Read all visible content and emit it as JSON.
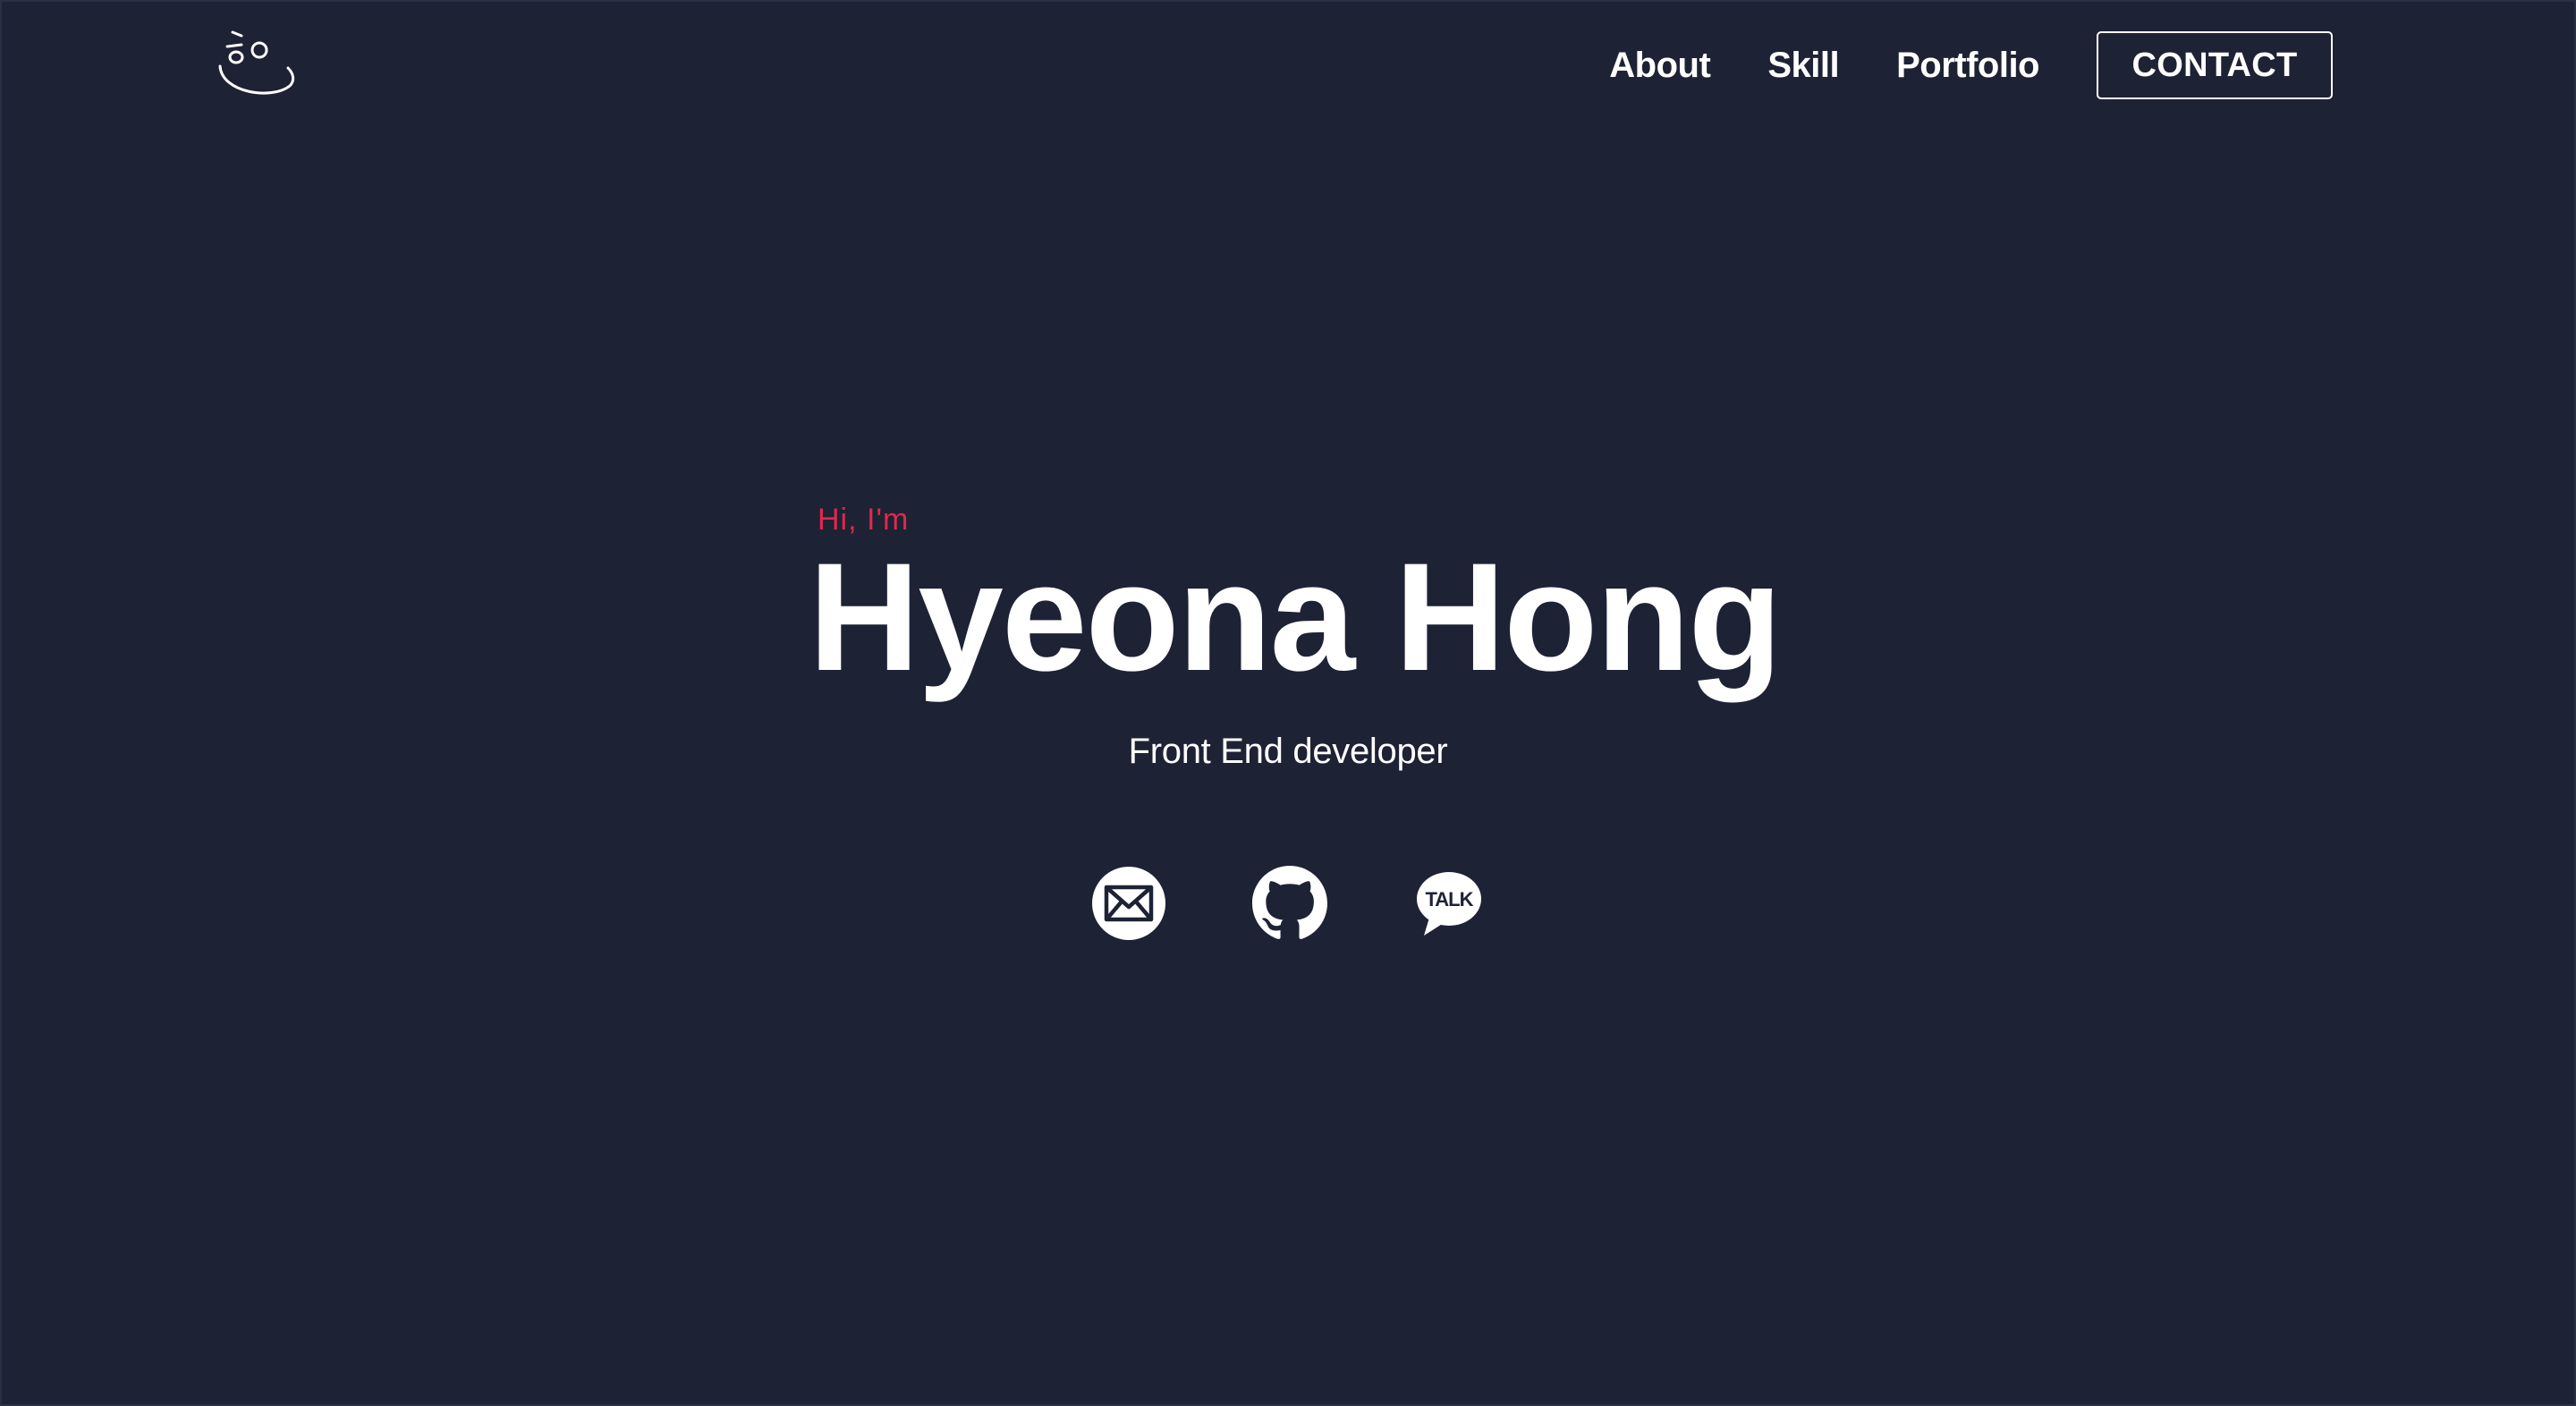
{
  "header": {
    "logo_icon": "smile-logo-icon",
    "nav": [
      {
        "label": "About"
      },
      {
        "label": "Skill"
      },
      {
        "label": "Portfolio"
      }
    ],
    "contact_label": "CONTACT"
  },
  "hero": {
    "greeting": "Hi, I'm",
    "name": "Hyeona Hong",
    "role": "Front End developer",
    "socials": [
      {
        "icon": "mail-icon"
      },
      {
        "icon": "github-icon"
      },
      {
        "icon": "kakaotalk-icon",
        "text": "TALK"
      }
    ]
  },
  "colors": {
    "background": "#1e2235",
    "accent": "#e0284c",
    "text": "#ffffff"
  }
}
